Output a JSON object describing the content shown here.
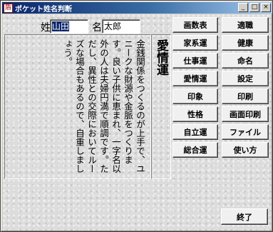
{
  "window": {
    "title": "ポケット姓名判断",
    "icon_char": "盾",
    "controls": {
      "minimize": "_",
      "maximize": "□",
      "close": "×"
    }
  },
  "name_form": {
    "surname_label": "姓",
    "surname_value": "山田",
    "given_label": "名",
    "given_value": "太郎"
  },
  "message": {
    "text": "金銭関係をつくるのが上手で、ユニークな財源や金脈をつくります。良い子供に恵まれ、一字名以外の人は夫婦円満で順調です。ただし、異性との交際においてルーズな場合もあるので、自重しましょう。"
  },
  "category": {
    "title": "愛情運"
  },
  "menu": {
    "left": [
      "画数表",
      "家系運",
      "仕事運",
      "愛情運",
      "印象",
      "性格",
      "自立運",
      "総合運"
    ],
    "right": [
      "適職",
      "健康",
      "命名",
      "設定",
      "印刷",
      "画面印刷",
      "ファイル",
      "使い方"
    ]
  },
  "footer": {
    "exit_label": "終了"
  }
}
